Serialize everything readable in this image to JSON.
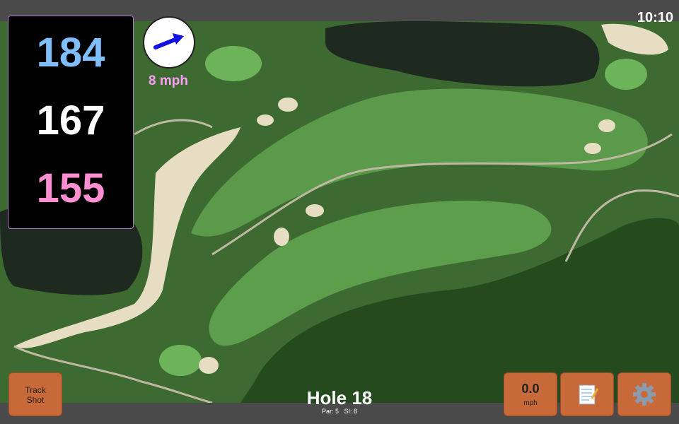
{
  "status": {
    "clock": "10:10"
  },
  "distances": {
    "back": "184",
    "middle": "167",
    "front": "155"
  },
  "colors": {
    "back": "#7fbfff",
    "middle": "#ffffff",
    "front": "#ff8fd0",
    "wind_text": "#ff9ff8",
    "wind_arrow": "#1010e0",
    "button": "#c8693a"
  },
  "wind": {
    "speed_label": "8 mph",
    "arrow_icon": "arrow-right-up-icon"
  },
  "buttons": {
    "track_line1": "Track",
    "track_line2": "Shot",
    "speed_value": "0.0",
    "speed_unit": "mph",
    "notes_icon": "notepad-icon",
    "settings_icon": "gear-icon"
  },
  "hole": {
    "title": "Hole 18",
    "par": "Par: 5",
    "si": "SI: 8"
  }
}
